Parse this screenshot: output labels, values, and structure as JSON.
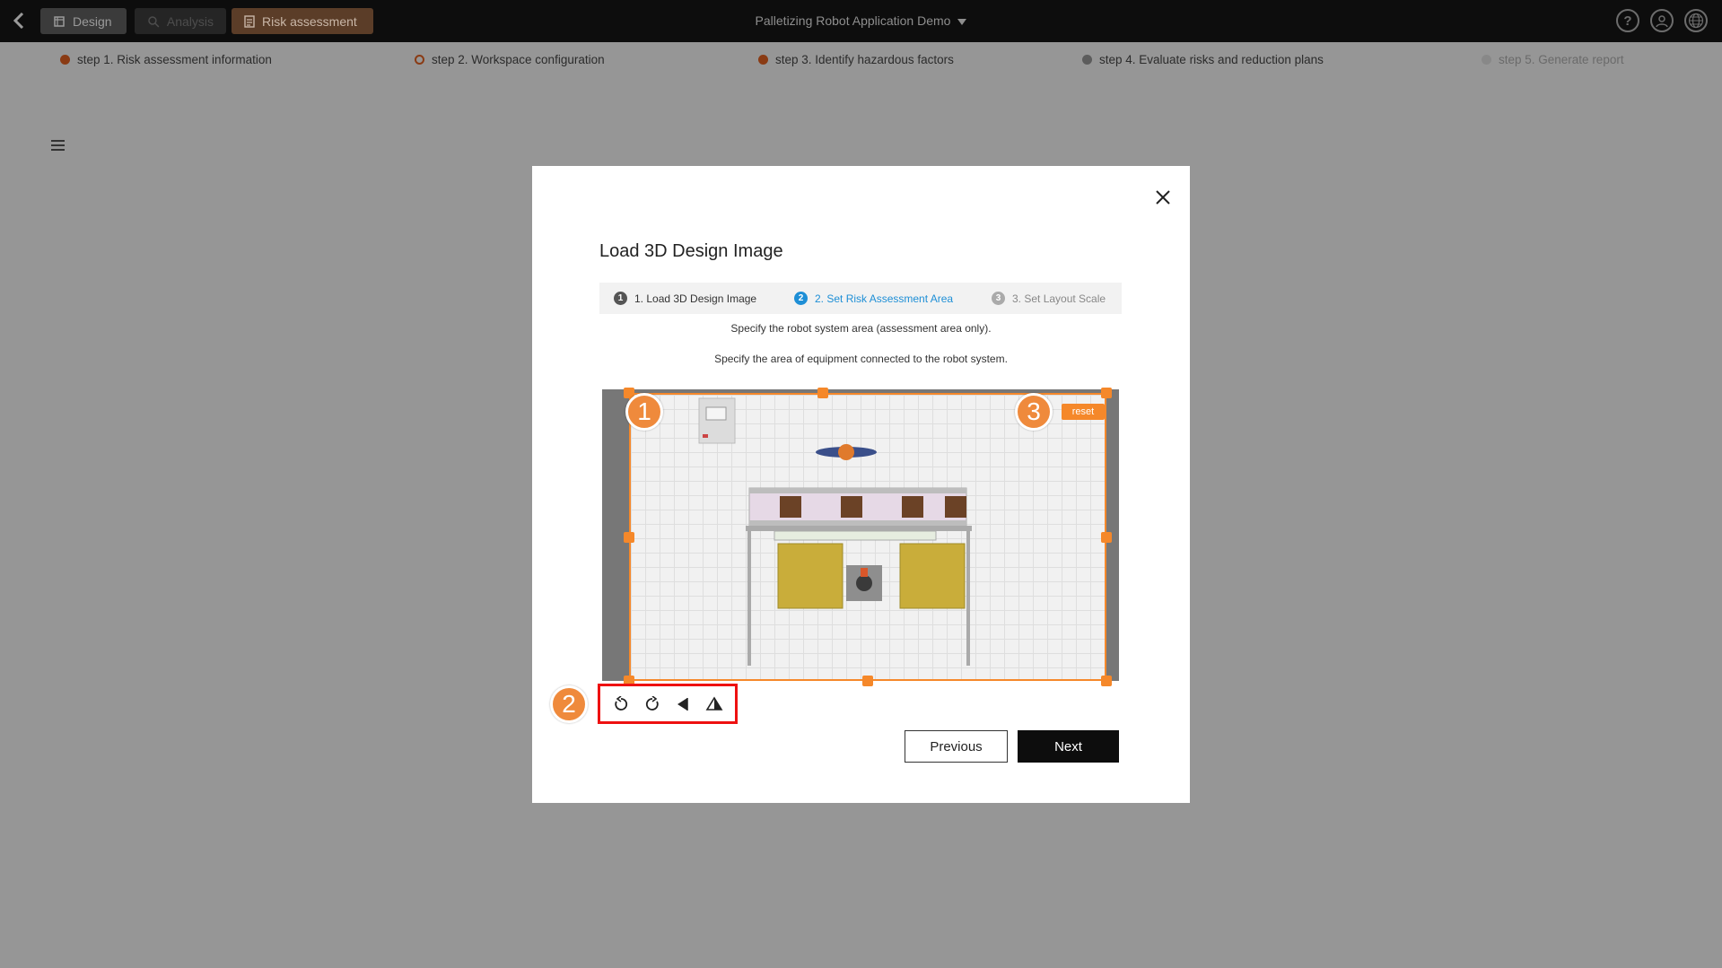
{
  "topbar": {
    "tabs": [
      {
        "label": "Design",
        "icon": "design-icon"
      },
      {
        "label": "Analysis",
        "icon": "analysis-search-icon"
      },
      {
        "label": "Risk assessment",
        "icon": "document-icon"
      }
    ],
    "app_title": "Palletizing Robot Application Demo",
    "icons": [
      "help-icon",
      "user-icon",
      "globe-icon"
    ]
  },
  "steps": [
    {
      "label": "step 1. Risk assessment information",
      "state": "done"
    },
    {
      "label": "step 2. Workspace configuration",
      "state": "current"
    },
    {
      "label": "step 3. Identify hazardous factors",
      "state": "done"
    },
    {
      "label": "step 4. Evaluate risks and reduction plans",
      "state": "pending"
    },
    {
      "label": "step 5. Generate report",
      "state": "disabled"
    }
  ],
  "modal": {
    "title": "Load 3D Design Image",
    "wizard": [
      {
        "num": "1",
        "label": "1. Load 3D Design Image",
        "state": "done"
      },
      {
        "num": "2",
        "label": "2. Set Risk Assessment Area",
        "state": "active"
      },
      {
        "num": "3",
        "label": "3. Set Layout Scale",
        "state": "todo"
      }
    ],
    "desc1": "Specify the robot system area (assessment area only).",
    "desc2": "Specify the area of equipment connected to the robot system.",
    "reset_label": "reset",
    "badges": [
      "1",
      "2",
      "3"
    ],
    "tools": [
      "rotate-left-icon",
      "rotate-right-icon",
      "flip-horizontal-icon",
      "flip-vertical-icon"
    ],
    "previous_label": "Previous",
    "next_label": "Next"
  },
  "colors": {
    "accent": "#f5882a",
    "step_dot": "#8a3b14",
    "wizard_active": "#1e8fd6",
    "highlight_box": "#ee1111"
  }
}
